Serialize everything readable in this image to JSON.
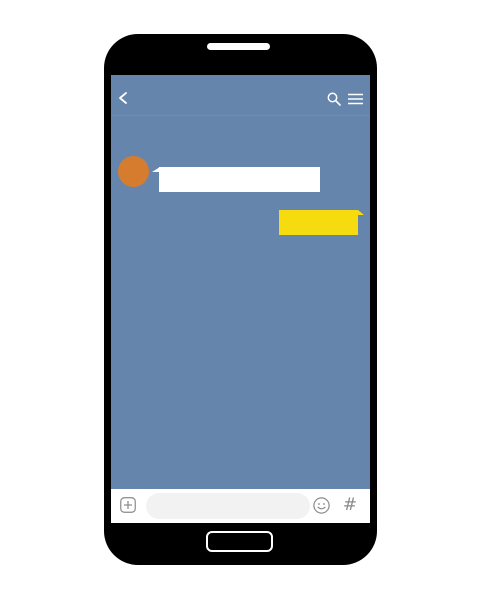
{
  "device": {
    "body_color": "#000000",
    "screen_color": "#6685ad"
  },
  "header": {
    "back_icon": "chevron-left-icon",
    "search_icon": "search-icon",
    "menu_icon": "hamburger-menu-icon"
  },
  "chat": {
    "messages": [
      {
        "side": "incoming",
        "text": "",
        "bubble_color": "#ffffff"
      },
      {
        "side": "outgoing",
        "text": "",
        "bubble_color": "#f6dc0f"
      }
    ],
    "avatar_color": "#d67c2e"
  },
  "composer": {
    "add_icon": "plus-square-icon",
    "input_value": "",
    "input_placeholder": "",
    "emoji_icon": "smiley-face-icon",
    "hash_icon": "hashtag-icon",
    "hash_symbol": "#"
  }
}
